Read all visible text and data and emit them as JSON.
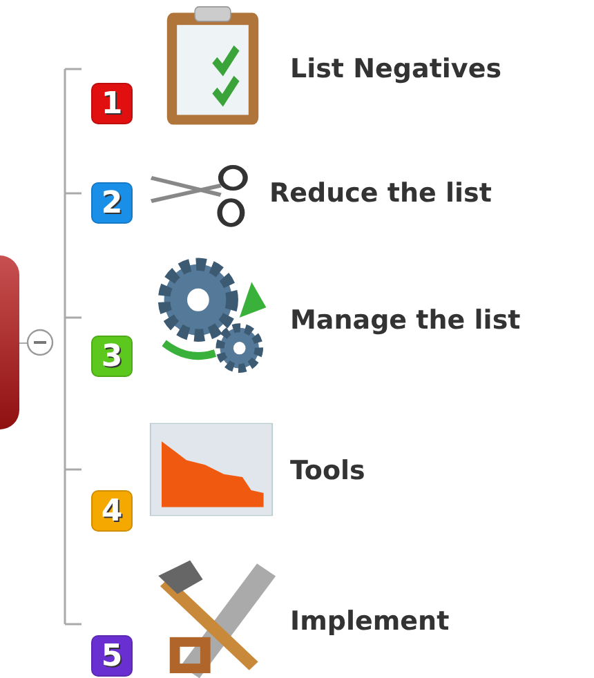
{
  "central_topic": {
    "expanded": true
  },
  "topics": [
    {
      "priority": "1",
      "color": "#e01010",
      "kind": "clipboard",
      "label": "List Negatives"
    },
    {
      "priority": "2",
      "color": "#1a8fe8",
      "kind": "scissors",
      "label": "Reduce the list"
    },
    {
      "priority": "3",
      "color": "#5cc81e",
      "kind": "gears",
      "label": "Manage the list"
    },
    {
      "priority": "4",
      "color": "#f5a800",
      "kind": "chart",
      "label": "Tools"
    },
    {
      "priority": "5",
      "color": "#6a2fd0",
      "kind": "tools",
      "label": "Implement"
    }
  ]
}
